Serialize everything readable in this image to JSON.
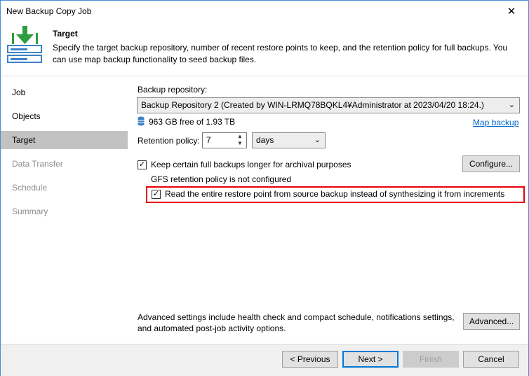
{
  "window": {
    "title": "New Backup Copy Job"
  },
  "header": {
    "title": "Target",
    "description": "Specify the target backup repository, number of recent restore points to keep, and the retention policy for full backups. You can use map backup functionality to seed backup files."
  },
  "sidebar": {
    "items": [
      {
        "label": "Job"
      },
      {
        "label": "Objects"
      },
      {
        "label": "Target"
      },
      {
        "label": "Data Transfer"
      },
      {
        "label": "Schedule"
      },
      {
        "label": "Summary"
      }
    ]
  },
  "content": {
    "repo_label": "Backup repository:",
    "repo_value": "Backup Repository 2 (Created by WIN-LRMQ78BQKL4¥Administrator at 2023/04/20 18:24.)",
    "free_space": "963 GB free of 1.93 TB",
    "map_backup": "Map backup",
    "retention_label": "Retention policy:",
    "retention_value": "7",
    "retention_unit": "days",
    "keep_full_label": "Keep certain full backups longer for archival purposes",
    "gfs_status": "GFS retention policy is not configured",
    "configure_btn": "Configure...",
    "read_entire_label": "Read the entire restore point from source backup instead of synthesizing it from increments",
    "advanced_text": "Advanced settings include health check and compact schedule, notifications settings, and automated post-job activity options.",
    "advanced_btn": "Advanced..."
  },
  "footer": {
    "previous": "< Previous",
    "next": "Next >",
    "finish": "Finish",
    "cancel": "Cancel"
  },
  "icons": {
    "close": "close-icon",
    "header": "target-download-icon",
    "database": "database-icon",
    "dropdown": "chevron-down-icon",
    "spin": "spin-arrows-icon",
    "check": "check-icon"
  },
  "colors": {
    "accent": "#0078d7",
    "highlight": "#e8000a",
    "icon_green": "#2e9e3e",
    "icon_blue": "#3d83c5"
  }
}
